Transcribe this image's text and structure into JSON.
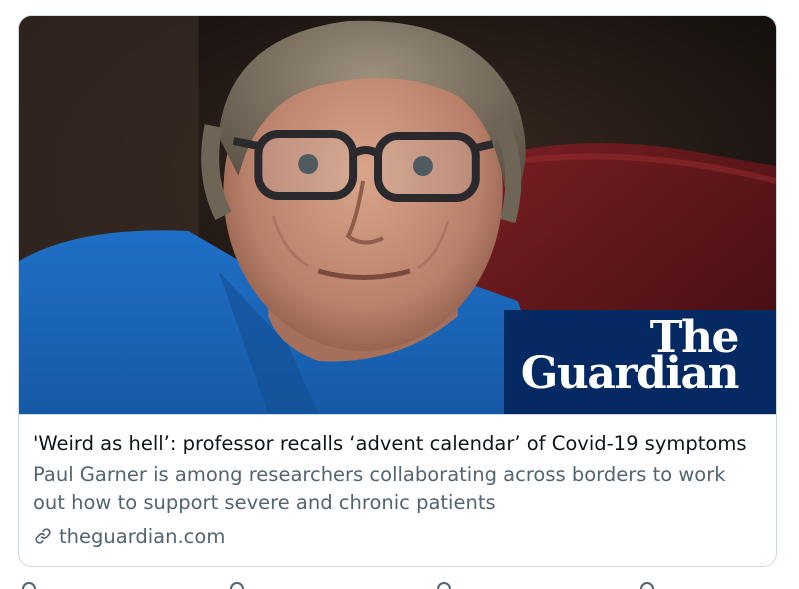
{
  "card": {
    "headline": "'Weird as hell’: professor recalls ‘advent calendar’ of Covid-19 symptoms",
    "description": "Paul Garner is among researchers collaborating across borders to work out how to support severe and chronic patients",
    "domain": "theguardian.com",
    "logo_line1": "The",
    "logo_line2": "Guardian",
    "link_icon": "link-icon"
  },
  "colors": {
    "guardian_blue": "#052962",
    "text_primary": "#0f1419",
    "text_secondary": "#536471",
    "border": "#cfd9de"
  }
}
